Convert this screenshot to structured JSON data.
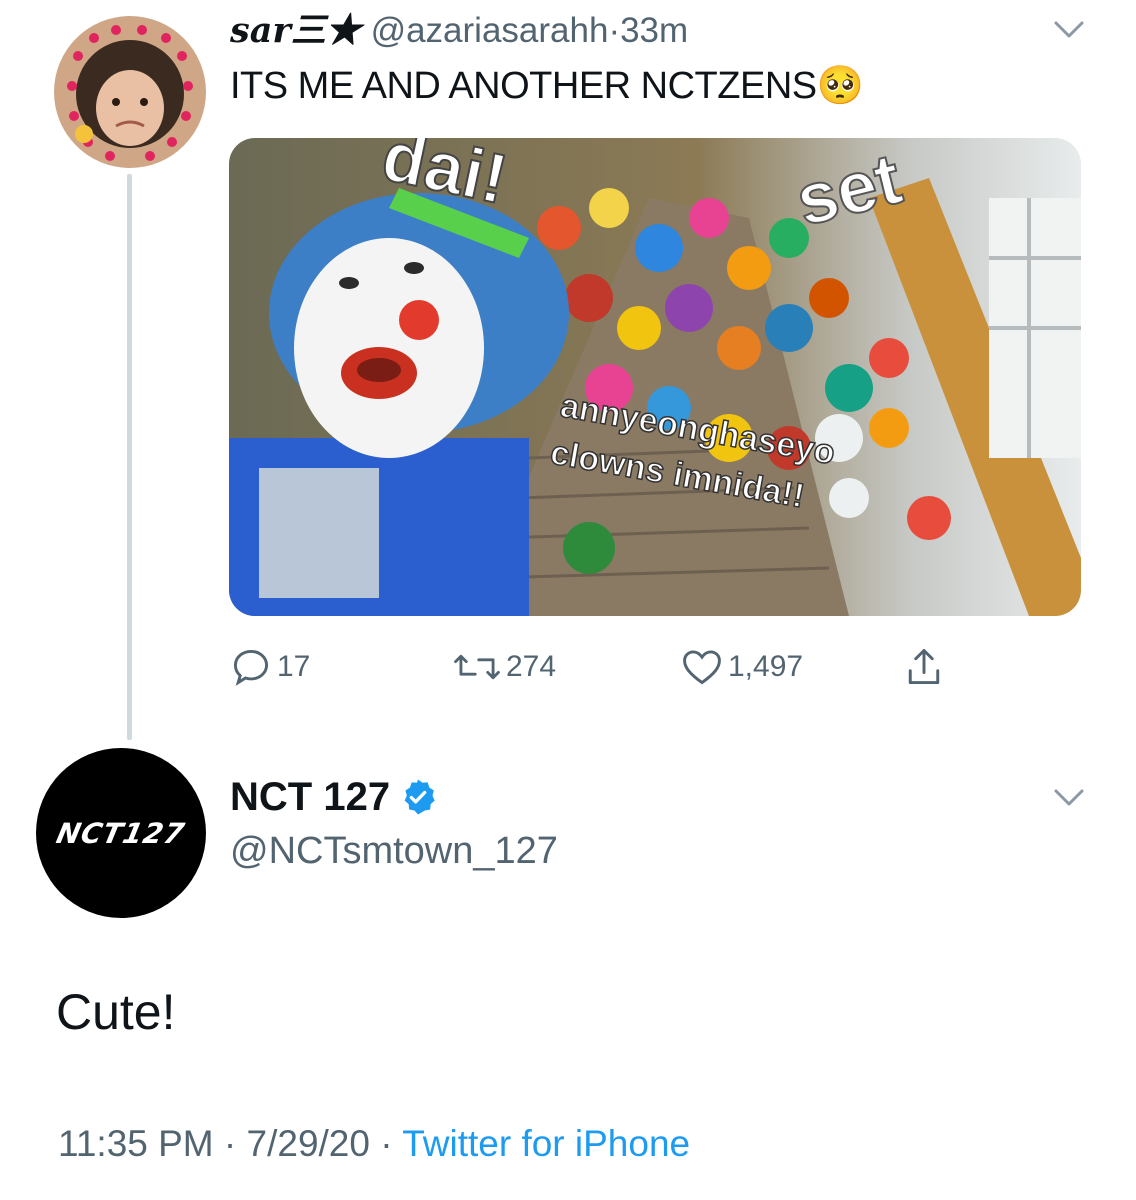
{
  "reply": {
    "display_name": "sar三★",
    "handle": "@azariasarahh",
    "dot": "·",
    "time": "33m",
    "text": "ITS ME AND ANOTHER NCTZENS",
    "emoji": "🥺",
    "media_caption_top": "set",
    "media_caption_top_left": "dai!",
    "media_caption_line1": "annyeonghaseyo",
    "media_caption_line2": "clowns imnida!!",
    "stats": {
      "replies": "17",
      "retweets": "274",
      "likes": "1,497"
    }
  },
  "tweet": {
    "display_name": "NCT 127",
    "handle": "@NCTsmtown_127",
    "avatar_logo": "NCT127",
    "text": "Cute!",
    "time": "11:35 PM",
    "date": "7/29/20",
    "sep": "·",
    "source": "Twitter for iPhone"
  },
  "colors": {
    "accent": "#1d9bf0",
    "secondary": "#536471",
    "line": "#cfd9de"
  },
  "icons": [
    "chevron-down-icon",
    "reply-icon",
    "retweet-icon",
    "like-icon",
    "share-icon",
    "verified-badge-icon"
  ]
}
